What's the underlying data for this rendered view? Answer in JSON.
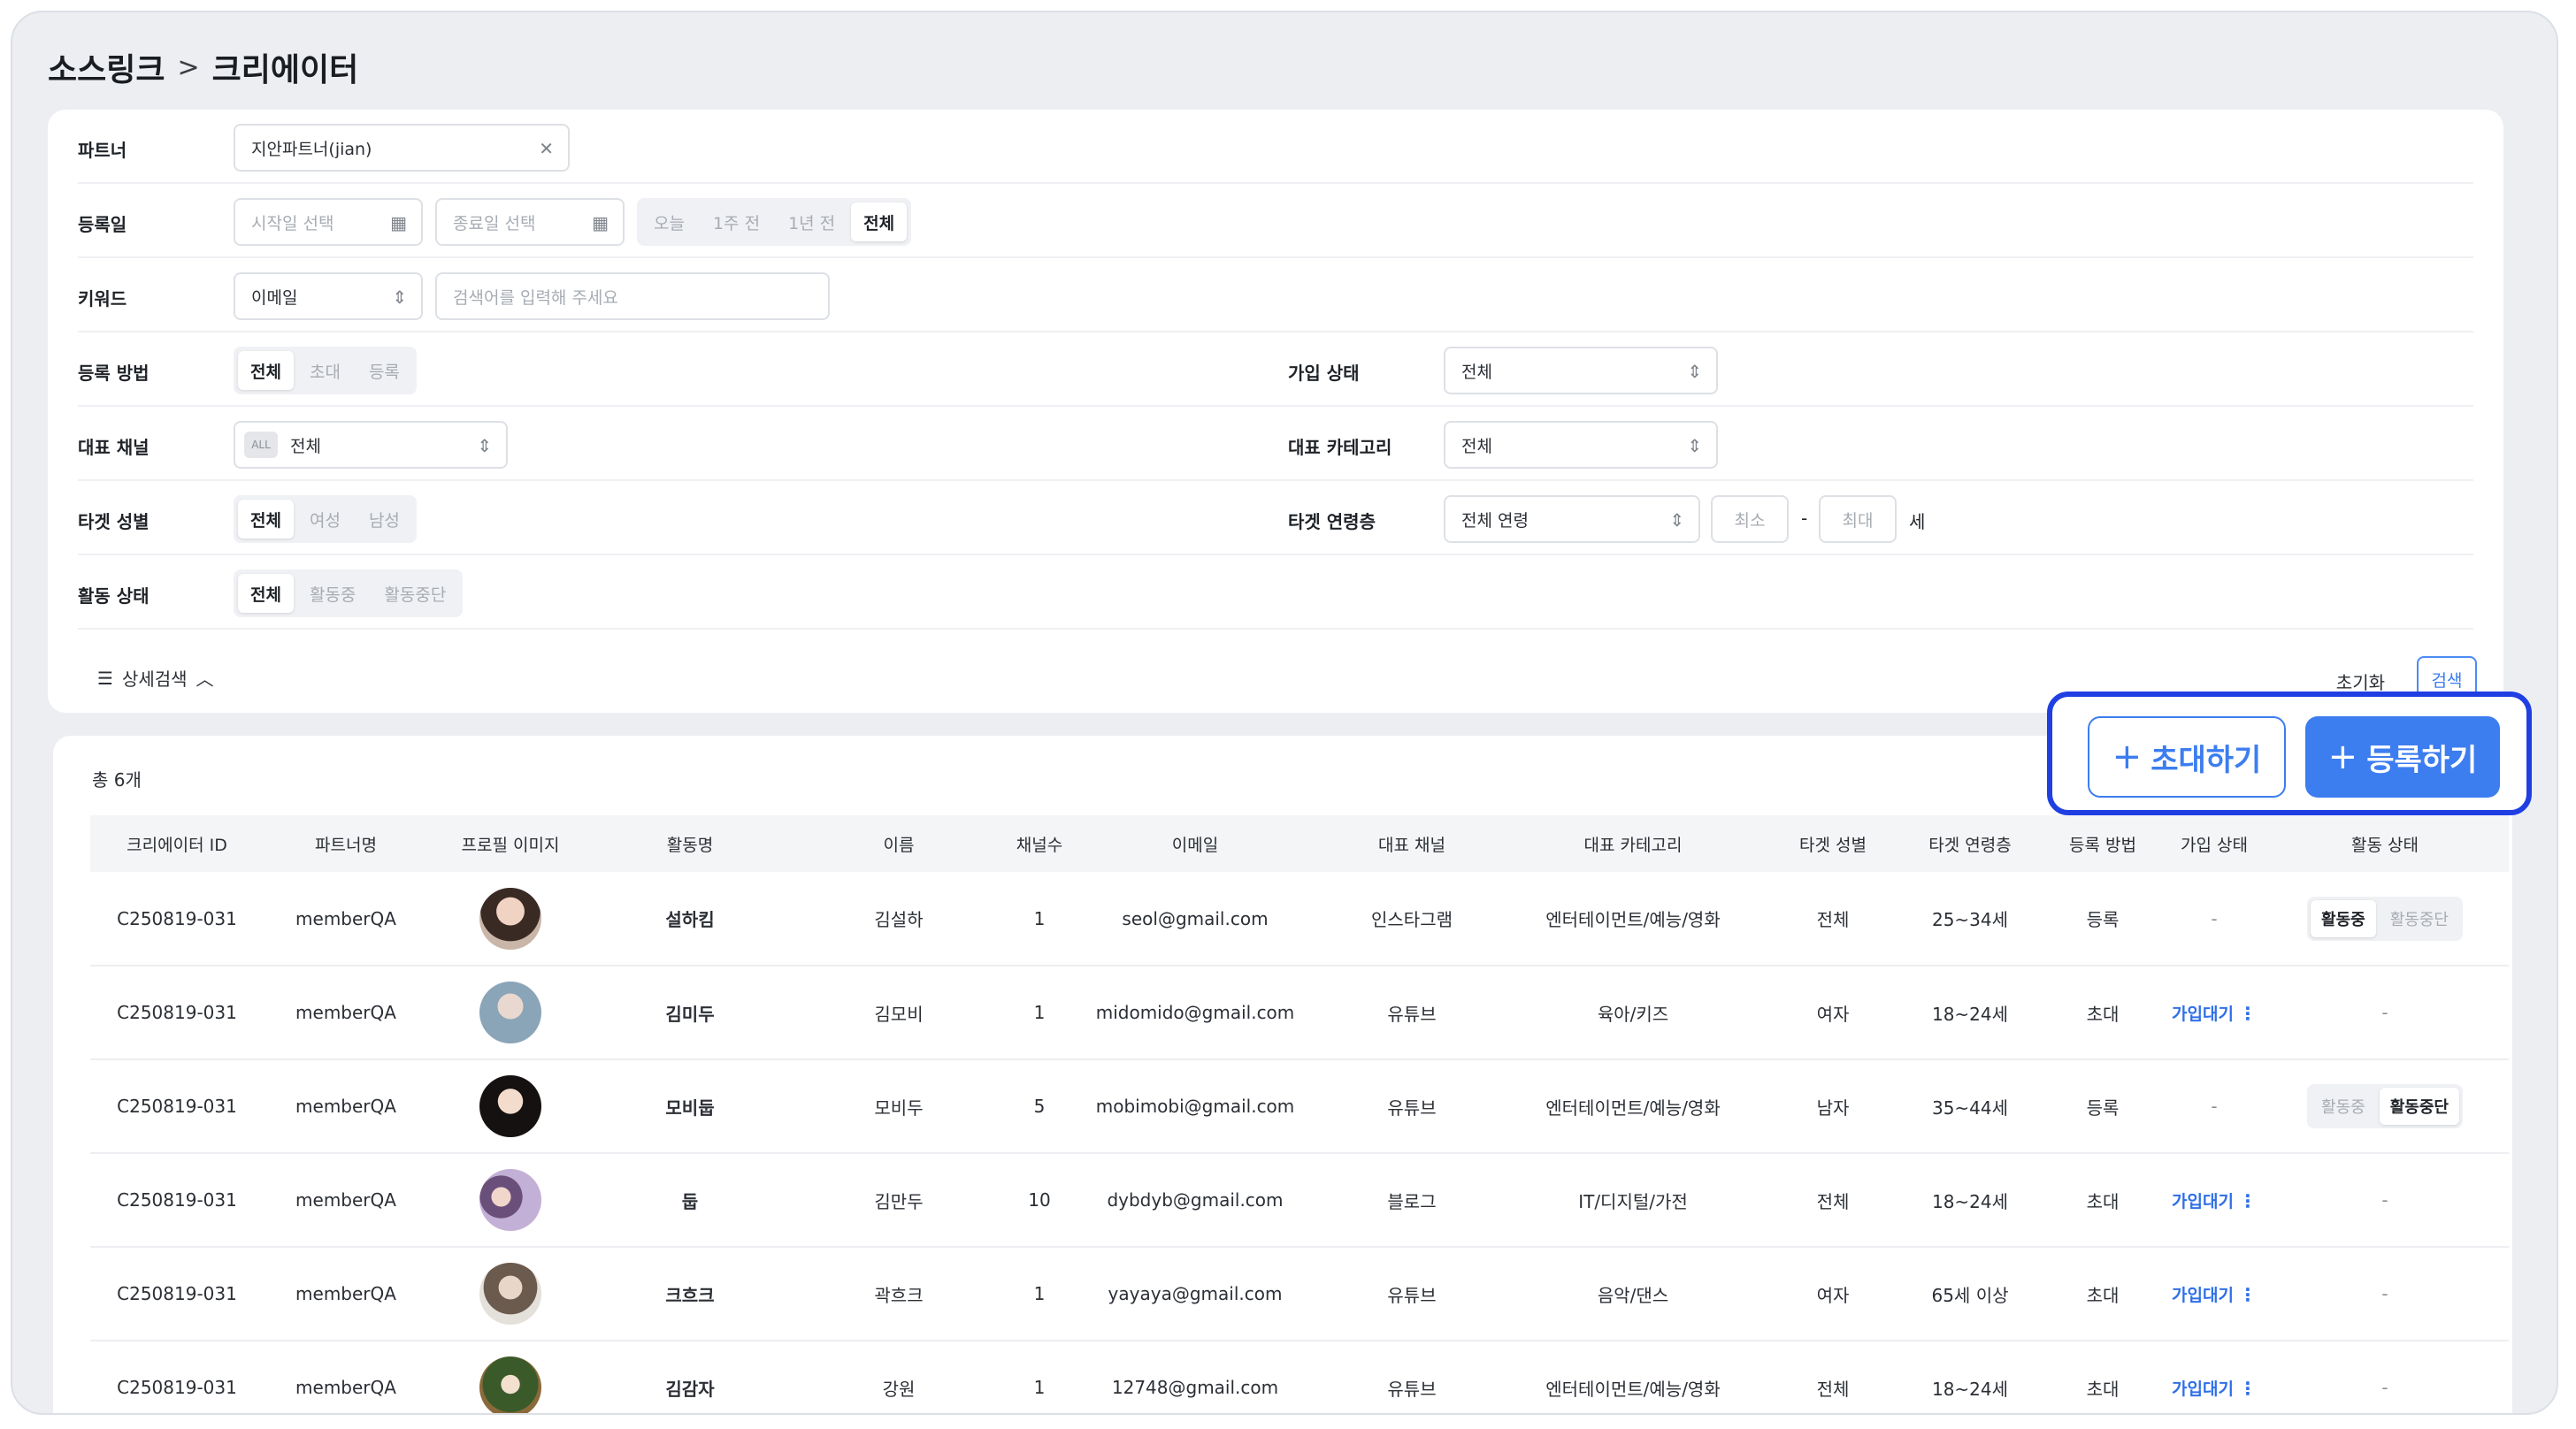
{
  "breadcrumb": {
    "root": "소스링크",
    "separator": ">",
    "current": "크리에이터"
  },
  "filters": {
    "partner": {
      "label": "파트너",
      "value": "지안파트너(jian)"
    },
    "regdate": {
      "label": "등록일",
      "start_placeholder": "시작일 선택",
      "end_placeholder": "종료일 선택",
      "ranges": [
        "오늘",
        "1주 전",
        "1년 전",
        "전체"
      ],
      "selected": "전체"
    },
    "keyword": {
      "label": "키워드",
      "type": "이메일",
      "placeholder": "검색어를 입력해 주세요"
    },
    "reg_method": {
      "label": "등록 방법",
      "options": [
        "전체",
        "초대",
        "등록"
      ],
      "selected": "전체"
    },
    "join_status": {
      "label": "가입 상태",
      "value": "전체"
    },
    "channel": {
      "label": "대표 채널",
      "badge": "ALL",
      "value": "전체"
    },
    "category": {
      "label": "대표 카테고리",
      "value": "전체"
    },
    "gender": {
      "label": "타겟 성별",
      "options": [
        "전체",
        "여성",
        "남성"
      ],
      "selected": "전체"
    },
    "age": {
      "label": "타겟 연령층",
      "value": "전체 연령",
      "min_placeholder": "최소",
      "dash": "-",
      "max_placeholder": "최대",
      "unit": "세"
    },
    "activity": {
      "label": "활동 상태",
      "options": [
        "전체",
        "활동중",
        "활동중단"
      ],
      "selected": "전체"
    },
    "detail_search": "상세검색",
    "reset": "초기화",
    "search": "검색"
  },
  "table": {
    "total": "총 6개",
    "invite_button": "초대하기",
    "register_button": "등록하기",
    "headers": [
      "크리에이터 ID",
      "파트너명",
      "프로필 이미지",
      "활동명",
      "이름",
      "채널수",
      "이메일",
      "대표 채널",
      "대표 카테고리",
      "타겟 성별",
      "타겟 연령층",
      "등록 방법",
      "가입 상태",
      "활동 상태"
    ],
    "rows": [
      {
        "id": "C250819-031",
        "partner": "memberQA",
        "nickname": "설하킴",
        "name": "김설하",
        "channels": "1",
        "email": "seol@gmail.com",
        "channel": "인스타그램",
        "category": "엔터테이먼트/예능/영화",
        "gender": "전체",
        "age": "25~34세",
        "method": "등록",
        "join": "-",
        "activity_on": "활동중",
        "activity_off": "활동중단",
        "activity_selected": "활동중"
      },
      {
        "id": "C250819-031",
        "partner": "memberQA",
        "nickname": "김미두",
        "name": "김모비",
        "channels": "1",
        "email": "midomido@gmail.com",
        "channel": "유튜브",
        "category": "육아/키즈",
        "gender": "여자",
        "age": "18~24세",
        "method": "초대",
        "join": "가입대기",
        "activity": "-"
      },
      {
        "id": "C250819-031",
        "partner": "memberQA",
        "nickname": "모비둡",
        "name": "모비두",
        "channels": "5",
        "email": "mobimobi@gmail.com",
        "channel": "유튜브",
        "category": "엔터테이먼트/예능/영화",
        "gender": "남자",
        "age": "35~44세",
        "method": "등록",
        "join": "-",
        "activity_on": "활동중",
        "activity_off": "활동중단",
        "activity_selected": "활동중단"
      },
      {
        "id": "C250819-031",
        "partner": "memberQA",
        "nickname": "둡",
        "name": "김만두",
        "channels": "10",
        "email": "dybdyb@gmail.com",
        "channel": "블로그",
        "category": "IT/디지털/가전",
        "gender": "전체",
        "age": "18~24세",
        "method": "초대",
        "join": "가입대기",
        "activity": "-"
      },
      {
        "id": "C250819-031",
        "partner": "memberQA",
        "nickname": "크흐크",
        "name": "곽흐크",
        "channels": "1",
        "email": "yayaya@gmail.com",
        "channel": "유튜브",
        "category": "음악/댄스",
        "gender": "여자",
        "age": "65세 이상",
        "method": "초대",
        "join": "가입대기",
        "activity": "-"
      },
      {
        "id": "C250819-031",
        "partner": "memberQA",
        "nickname": "김감자",
        "name": "강원",
        "channels": "1",
        "email": "12748@gmail.com",
        "channel": "유튜브",
        "category": "엔터테이먼트/예능/영화",
        "gender": "전체",
        "age": "18~24세",
        "method": "초대",
        "join": "가입대기",
        "activity": "-"
      }
    ]
  },
  "colors": {
    "accent": "#3c7df0",
    "highlight_border": "#1f3fe3",
    "background": "#eceef2"
  }
}
